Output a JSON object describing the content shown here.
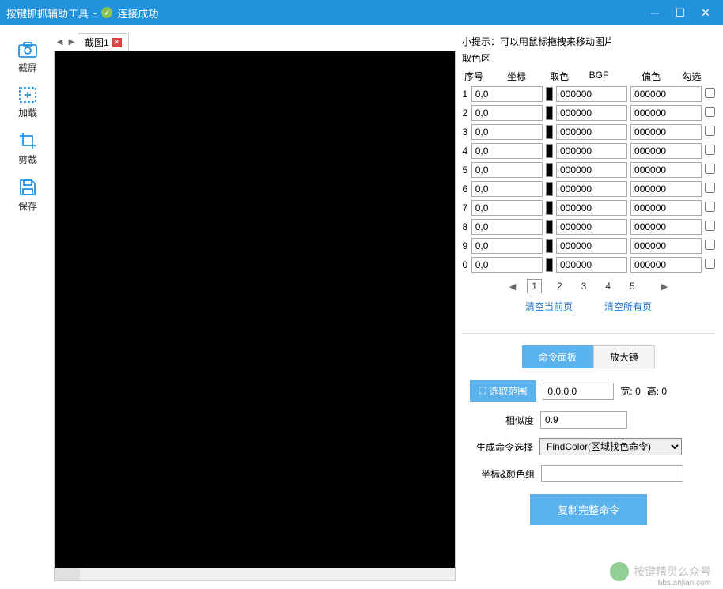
{
  "titlebar": {
    "app_name": "按键抓抓辅助工具",
    "separator": "-",
    "status": "连接成功"
  },
  "toolbar": {
    "screenshot": "截屏",
    "load": "加载",
    "crop": "剪裁",
    "save": "保存"
  },
  "tabs": {
    "tab1": "截图1"
  },
  "right": {
    "hint": "小提示：可以用鼠标拖拽来移动图片",
    "section": "取色区",
    "headers": {
      "idx": "序号",
      "coord": "坐标",
      "color": "取色",
      "bgf": "BGF",
      "offset": "偏色",
      "check": "勾选"
    },
    "rows": [
      {
        "idx": "1",
        "coord": "0,0",
        "bgf": "000000",
        "offset": "000000"
      },
      {
        "idx": "2",
        "coord": "0,0",
        "bgf": "000000",
        "offset": "000000"
      },
      {
        "idx": "3",
        "coord": "0,0",
        "bgf": "000000",
        "offset": "000000"
      },
      {
        "idx": "4",
        "coord": "0,0",
        "bgf": "000000",
        "offset": "000000"
      },
      {
        "idx": "5",
        "coord": "0,0",
        "bgf": "000000",
        "offset": "000000"
      },
      {
        "idx": "6",
        "coord": "0,0",
        "bgf": "000000",
        "offset": "000000"
      },
      {
        "idx": "7",
        "coord": "0,0",
        "bgf": "000000",
        "offset": "000000"
      },
      {
        "idx": "8",
        "coord": "0,0",
        "bgf": "000000",
        "offset": "000000"
      },
      {
        "idx": "9",
        "coord": "0,0",
        "bgf": "000000",
        "offset": "000000"
      },
      {
        "idx": "0",
        "coord": "0,0",
        "bgf": "000000",
        "offset": "000000"
      }
    ],
    "pages": [
      "1",
      "2",
      "3",
      "4",
      "5"
    ],
    "clear_current": "清空当前页",
    "clear_all": "清空所有页"
  },
  "cmd": {
    "tab_cmd": "命令面板",
    "tab_zoom": "放大镜",
    "range_btn": "选取范围",
    "range_val": "0,0,0,0",
    "width_label": "宽: 0",
    "height_label": "高: 0",
    "similarity_label": "相似度",
    "similarity_val": "0.9",
    "gen_label": "生成命令选择",
    "gen_val": "FindColor(区域找色命令)",
    "coord_label": "坐标&颜色组",
    "coord_val": "",
    "copy_btn": "复制完整命令"
  },
  "watermark": {
    "text": "按键精灵么众号",
    "site": "bbs.anjian.com"
  }
}
